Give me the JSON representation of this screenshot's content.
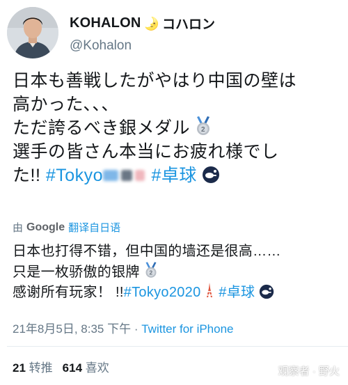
{
  "profile": {
    "display_name": "KOHALON",
    "moon_glyph": "🌛",
    "katakana_name": "コハロン",
    "handle": "@Kohalon"
  },
  "tweet": {
    "line1": "日本も善戦したがやはり中国の壁は",
    "line2": "高かった､､､",
    "line3": "ただ誇るべき銀メダル",
    "line4": "選手の皆さん本当にお疲れ様でし",
    "line5_prefix": "た!! ",
    "hashtag_partial": "#Tokyo",
    "hashtag_pingpong": "#卓球"
  },
  "translation": {
    "by_label": "由",
    "provider": "Google",
    "link_label": "翻译自日语",
    "line1": "日本也打得不错，但中国的墙还是很高……",
    "line2": "只是一枚骄傲的银牌",
    "line3_prefix": "感谢所有玩家！ !!",
    "hashtag_tokyo": "#Tokyo2020",
    "hashtag_pingpong": "#卓球"
  },
  "meta": {
    "timestamp": "21年8月5日, 8:35 下午",
    "separator": "·",
    "source": "Twitter for iPhone"
  },
  "stats": {
    "retweets_count": "21",
    "retweets_label": "转推",
    "likes_count": "614",
    "likes_label": "喜欢"
  },
  "watermark": "观察者 · 野火",
  "colors": {
    "link": "#1b95e0",
    "text": "#14171a",
    "secondary": "#657786"
  },
  "icons": {
    "medal": "silver-medal-icon",
    "tower": "tokyo-tower-icon",
    "pingpong": "ping-pong-icon"
  }
}
